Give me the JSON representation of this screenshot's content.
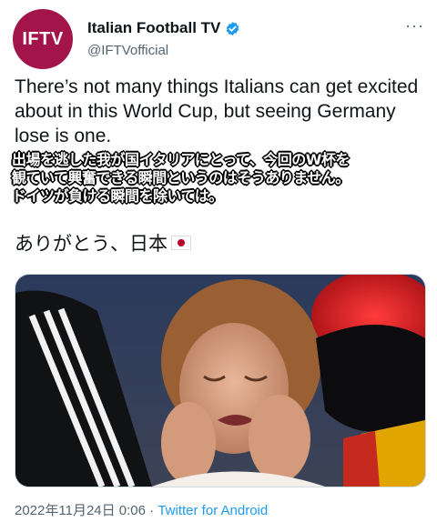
{
  "account": {
    "avatar_text": "IFTV",
    "display_name": "Italian Football TV",
    "handle": "@IFTVofficial",
    "verified": true
  },
  "more_label": "···",
  "tweet": {
    "text": "There’s not many things Italians can get excited about in this World Cup, but seeing Germany lose is one.",
    "overlay_lines": [
      "出場を逃した我が国イタリアにとって、今回のW杯を",
      "観ていて興奮できる瞬間というのはそうありません。",
      "ドイツが負ける瞬間を除いては。"
    ],
    "thanks": "ありがとう、日本",
    "flag_icon": "japan-flag-icon"
  },
  "footer": {
    "timestamp": "2022年11月24日 0:06",
    "separator": "·",
    "source": "Twitter for Android"
  },
  "colors": {
    "avatar_bg": "#a3154a",
    "verified_blue": "#1d9bf0",
    "link_blue": "#1d9bf0"
  }
}
